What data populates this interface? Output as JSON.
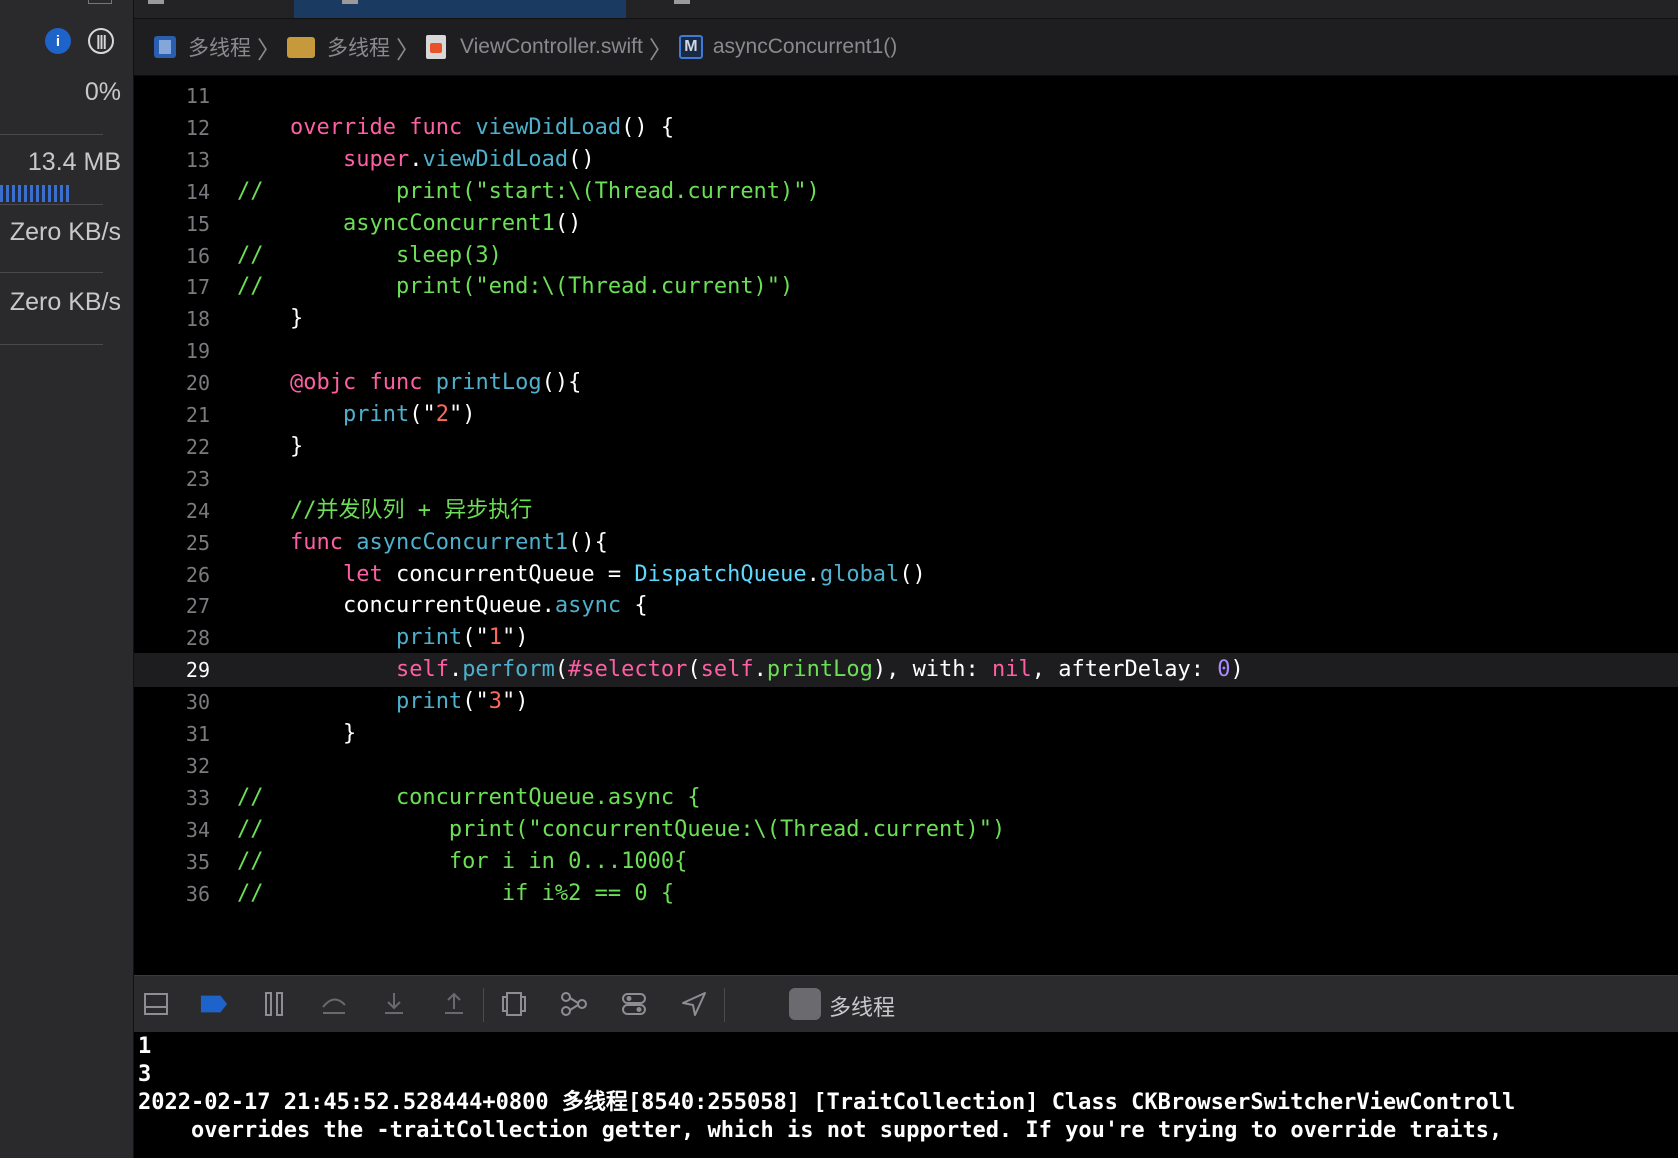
{
  "left_panel": {
    "cpu_value": "0%",
    "memory_value": "13.4 MB",
    "disk_value": "Zero KB/s",
    "network_value": "Zero KB/s",
    "cpu_icon": "cpu-gauge-icon",
    "memory_icon": "memory-gauge-icon"
  },
  "jumpbar": {
    "crumbs": [
      {
        "label": "多线程",
        "icon": "project-icon"
      },
      {
        "label": "多线程",
        "icon": "folder-icon"
      },
      {
        "label": "ViewController.swift",
        "icon": "swift-file-icon"
      },
      {
        "label": "asyncConcurrent1()",
        "icon": "method-icon",
        "icon_letter": "M"
      }
    ]
  },
  "editor": {
    "current_line": "29",
    "lines": [
      {
        "n": "11",
        "code": ""
      },
      {
        "n": "12",
        "code": "    override func viewDidLoad() {"
      },
      {
        "n": "13",
        "code": "        super.viewDidLoad()"
      },
      {
        "n": "14",
        "code": "//          print(\"start:\\(Thread.current)\")"
      },
      {
        "n": "15",
        "code": "        asyncConcurrent1()"
      },
      {
        "n": "16",
        "code": "//          sleep(3)"
      },
      {
        "n": "17",
        "code": "//          print(\"end:\\(Thread.current)\")"
      },
      {
        "n": "18",
        "code": "    }"
      },
      {
        "n": "19",
        "code": ""
      },
      {
        "n": "20",
        "code": "    @objc func printLog(){"
      },
      {
        "n": "21",
        "code": "        print(\"2\")"
      },
      {
        "n": "22",
        "code": "    }"
      },
      {
        "n": "23",
        "code": ""
      },
      {
        "n": "24",
        "code": "    //并发队列 + 异步执行"
      },
      {
        "n": "25",
        "code": "    func asyncConcurrent1(){"
      },
      {
        "n": "26",
        "code": "        let concurrentQueue = DispatchQueue.global()"
      },
      {
        "n": "27",
        "code": "        concurrentQueue.async {"
      },
      {
        "n": "28",
        "code": "            print(\"1\")"
      },
      {
        "n": "29",
        "code": "            self.perform(#selector(self.printLog), with: nil, afterDelay: 0)"
      },
      {
        "n": "30",
        "code": "            print(\"3\")"
      },
      {
        "n": "31",
        "code": "        }"
      },
      {
        "n": "32",
        "code": ""
      },
      {
        "n": "33",
        "code": "//          concurrentQueue.async {"
      },
      {
        "n": "34",
        "code": "//              print(\"concurrentQueue:\\(Thread.current)\")"
      },
      {
        "n": "35",
        "code": "//              for i in 0...1000{"
      },
      {
        "n": "36",
        "code": "//                  if i%2 == 0 {"
      }
    ]
  },
  "debug_toolbar": {
    "icons": [
      "hide-console-icon",
      "breakpoints-toggle-icon",
      "pause-icon",
      "step-over-icon",
      "step-into-icon",
      "step-out-icon",
      "view-debugger-icon",
      "memory-graph-icon",
      "environment-overrides-icon",
      "simulate-location-icon"
    ],
    "scheme_label": "多线程",
    "accent_color": "#1d63c9"
  },
  "console": {
    "lines": [
      "1",
      "3",
      "2022-02-17 21:45:52.528444+0800 多线程[8540:255058] [TraitCollection] Class CKBrowserSwitcherViewControll",
      "    overrides the -traitCollection getter, which is not supported. If you're trying to override traits,"
    ]
  }
}
